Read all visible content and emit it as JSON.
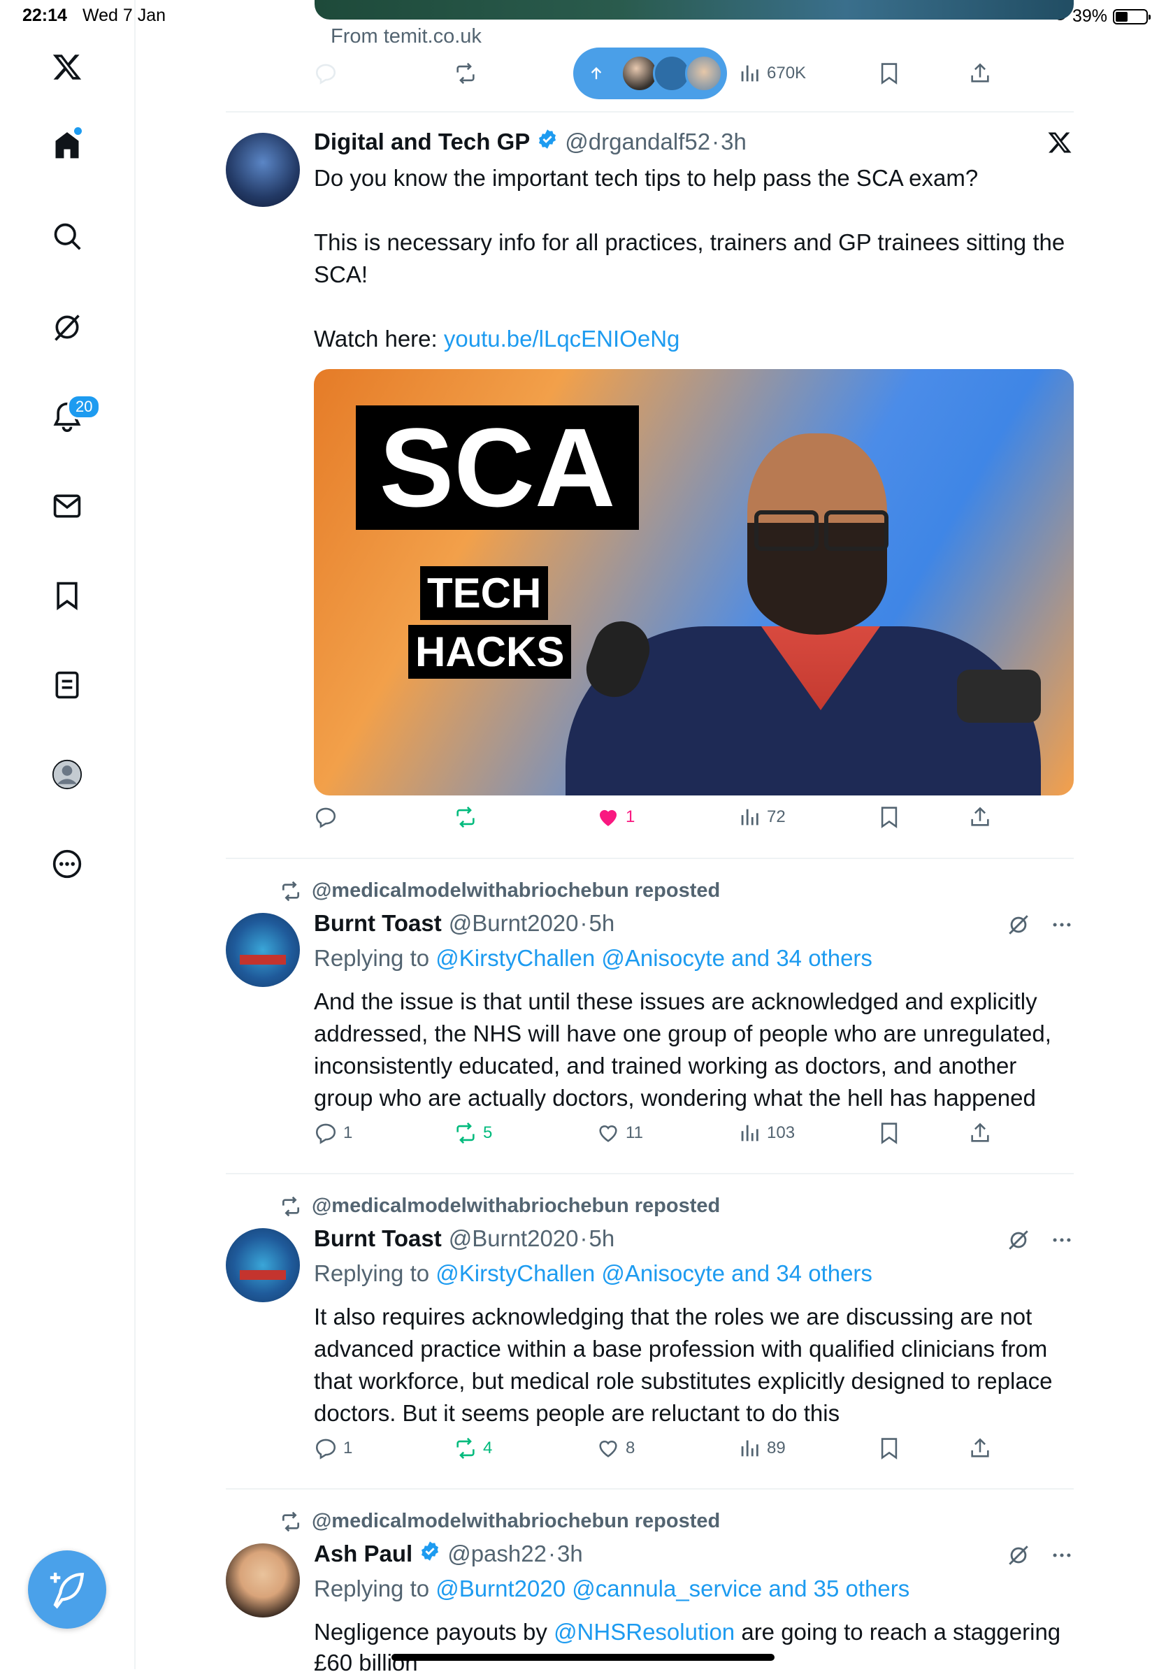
{
  "status_bar": {
    "time": "22:14",
    "date": "Wed 7 Jan",
    "battery": "39%"
  },
  "sidebar": {
    "items": [
      {
        "name": "x-logo"
      },
      {
        "name": "home"
      },
      {
        "name": "explore"
      },
      {
        "name": "grok"
      },
      {
        "name": "notifications",
        "badge": "20"
      },
      {
        "name": "messages"
      },
      {
        "name": "bookmarks"
      },
      {
        "name": "lists"
      },
      {
        "name": "profile"
      },
      {
        "name": "more"
      }
    ]
  },
  "top_fragment": {
    "from_text": "From temit.co.uk",
    "views": "670K"
  },
  "tweets": [
    {
      "name": "Digital and Tech GP",
      "verified": true,
      "handle": "@drgandalf52",
      "time": "3h",
      "lines": [
        "Do you know the important tech tips to help pass the SCA exam?",
        "This is necessary info for all practices, trainers and GP trainees sitting the SCA!",
        "Watch here:"
      ],
      "link": "youtu.be/lLqcENIOeNg",
      "media": {
        "title": "SCA",
        "tag1": "TECH",
        "tag2": "HACKS"
      },
      "replies": "",
      "reposts": "",
      "likes": "1",
      "views": "72"
    },
    {
      "reposted_by": "@medicalmodelwithabriochebun reposted",
      "name": "Burnt Toast",
      "handle": "@Burnt2020",
      "time": "5h",
      "reply_prefix": "Replying to",
      "reply_to": "@KirstyChallen @Anisocyte and 34 others",
      "text": "And the issue is that until these issues are acknowledged and explicitly addressed, the NHS will have one group of people who are unregulated, inconsistently educated, and trained working as doctors, and another group who are actually doctors, wondering what the hell has happened",
      "replies": "1",
      "reposts": "5",
      "likes": "11",
      "views": "103"
    },
    {
      "reposted_by": "@medicalmodelwithabriochebun reposted",
      "name": "Burnt Toast",
      "handle": "@Burnt2020",
      "time": "5h",
      "reply_prefix": "Replying to",
      "reply_to": "@KirstyChallen @Anisocyte and 34 others",
      "text": "It also requires acknowledging that the roles we are discussing are not advanced practice within a base profession with qualified clinicians from that workforce, but medical role substitutes explicitly designed to replace doctors. But it seems people are reluctant to do this",
      "replies": "1",
      "reposts": "4",
      "likes": "8",
      "views": "89"
    },
    {
      "reposted_by": "@medicalmodelwithabriochebun reposted",
      "name": "Ash Paul",
      "verified": true,
      "handle": "@pash22",
      "time": "3h",
      "reply_prefix": "Replying to",
      "reply_to": "@Burnt2020 @cannula_service and 35 others",
      "text_before": "Negligence payouts by",
      "mention": "@NHSResolution",
      "text_after": "are going to reach a staggering",
      "text_line2": "£60 billion"
    }
  ],
  "colors": {
    "accent": "#1d9bf0",
    "like": "#f91880",
    "repost": "#00ba7c",
    "muted": "#536471"
  }
}
